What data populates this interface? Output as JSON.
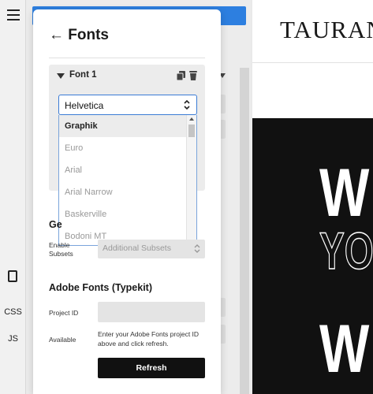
{
  "panel": {
    "title": "← Fonts"
  },
  "font_card": {
    "title": "Font 1",
    "select": {
      "value": "Helvetica",
      "options": [
        "Graphik",
        "Euro",
        "Arial",
        "Arial Narrow",
        "Baskerville",
        "Bodoni MT"
      ],
      "highlighted": "Graphik"
    }
  },
  "general": {
    "heading": "Ge",
    "subsets_label": "Enable Subsets",
    "subsets_placeholder": "Additional Subsets"
  },
  "adobe": {
    "heading": "Adobe Fonts (Typekit)",
    "project_id_label": "Project ID",
    "project_id_value": "",
    "available_label": "Available",
    "help_text": "Enter your Adobe Fonts project ID above and click refresh.",
    "refresh_label": "Refresh"
  },
  "rail": {
    "css_label": "CSS",
    "js_label": "JS"
  },
  "preview": {
    "logo": "TAURAN",
    "hero_lines": [
      "W",
      "YO",
      "W"
    ]
  },
  "colors": {
    "accent_blue": "#2d7fe0",
    "select_border": "#3a7bd5",
    "button_bg": "#111111",
    "preview_bg": "#111111"
  }
}
